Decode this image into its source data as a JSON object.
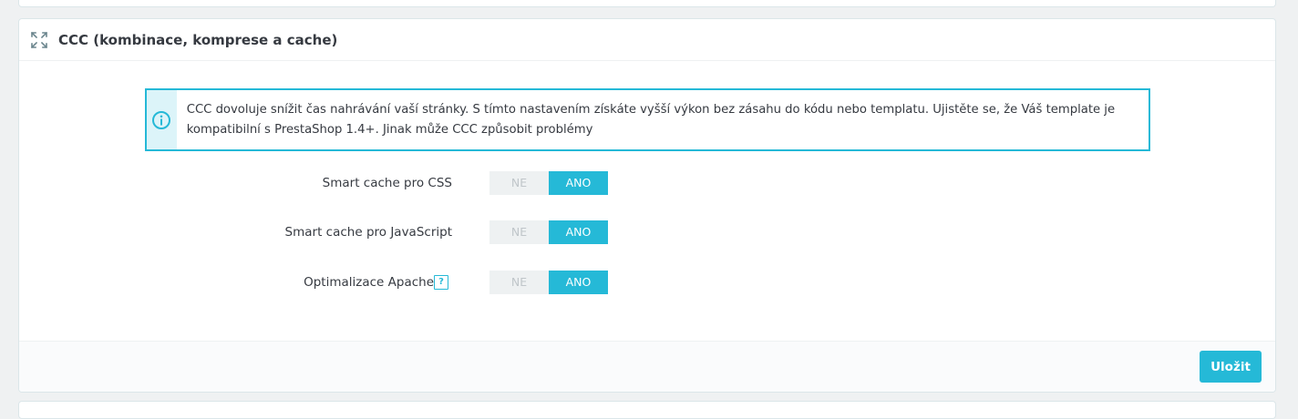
{
  "panel": {
    "title": "CCC (kombinace, komprese a cache)",
    "icon": "expand-icon"
  },
  "alert": {
    "icon": "info-icon",
    "text": "CCC dovoluje snížit čas nahrávání vaší stránky. S tímto nastavením získáte vyšší výkon bez zásahu do kódu nebo templatu. Ujistěte se, že Váš template je kompatibilní s PrestaShop 1.4+. Jinak může CCC způsobit problémy"
  },
  "settings": [
    {
      "label": "Smart cache pro CSS",
      "off_label": "NE",
      "on_label": "ANO",
      "value": "ANO"
    },
    {
      "label": "Smart cache pro JavaScript",
      "off_label": "NE",
      "on_label": "ANO",
      "value": "ANO"
    },
    {
      "label": "Optimalizace Apache",
      "help": "?",
      "off_label": "NE",
      "on_label": "ANO",
      "value": "ANO"
    }
  ],
  "footer": {
    "save_label": "Uložit"
  },
  "colors": {
    "accent": "#25b9d7",
    "alert_bg": "#dcf4f9",
    "background": "#eff1f2"
  }
}
